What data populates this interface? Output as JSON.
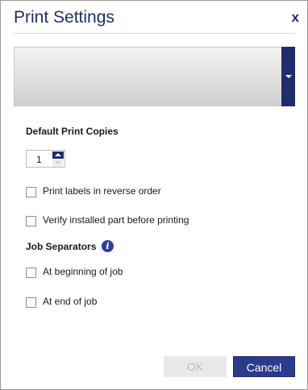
{
  "dialog": {
    "title": "Print Settings",
    "close_label": "x"
  },
  "printer_select": {
    "value": ""
  },
  "copies": {
    "label": "Default Print Copies",
    "value": "1"
  },
  "options": {
    "reverse_order": {
      "label": "Print labels in reverse order",
      "checked": false
    },
    "verify_part": {
      "label": "Verify installed part before printing",
      "checked": false
    }
  },
  "job_separators": {
    "label": "Job Separators",
    "beginning": {
      "label": "At beginning of job",
      "checked": false
    },
    "end": {
      "label": "At end of job",
      "checked": false
    }
  },
  "buttons": {
    "ok_label": "OK",
    "ok_enabled": false,
    "cancel_label": "Cancel"
  },
  "colors": {
    "accent": "#1f2d6b",
    "button_primary": "#2b3a8c",
    "info_icon": "#2d3fa0"
  },
  "icons": {
    "close": "close-icon",
    "dropdown": "chevron-down-icon",
    "info": "info-icon",
    "step_up": "arrow-up-icon",
    "step_down": "arrow-down-icon"
  }
}
